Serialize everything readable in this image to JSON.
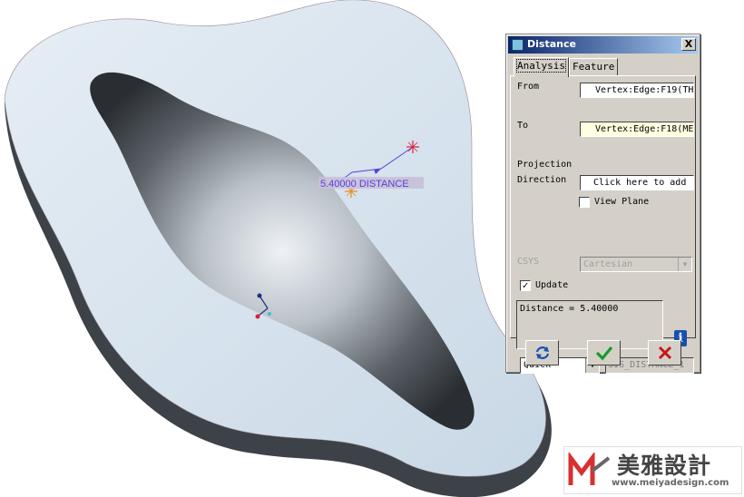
{
  "viewport": {
    "measure_label": "5.40000  DISTANCE"
  },
  "dialog": {
    "title": "Distance",
    "close_label": "X",
    "tabs": [
      {
        "label": "Analysis",
        "active": true
      },
      {
        "label": "Feature",
        "active": false
      }
    ],
    "from_label": "From",
    "from_value": "Vertex:Edge:F19(TH",
    "to_label": "To",
    "to_value": "Vertex:Edge:F18(ME",
    "projection_label": "Projection",
    "direction_label": "Direction",
    "direction_value": "Click here to add",
    "view_plane_label": "View Plane",
    "view_plane_checked": false,
    "csys_label": "CSYS",
    "csys_value": "Cartesian",
    "update_label": "Update",
    "update_checked": true,
    "result_text": "Distance = 5.40000",
    "mode_value": "Quick",
    "analysis_name": "ANALYSIS_DISTANCE_1",
    "buttons": [
      "repeat-icon",
      "ok-check-icon",
      "cancel-x-icon"
    ]
  },
  "watermark": {
    "brand_mark": "M",
    "chinese": "美雅設計",
    "url": "www.meiyadesign.com"
  },
  "colors": {
    "titlebar": "#0a246a",
    "dialog_bg": "#d4d0c8",
    "highlight_field": "#ffffe0",
    "model_top": "#d8e4ee",
    "model_side": "#40474e",
    "measure_line": "#5a40d8"
  }
}
